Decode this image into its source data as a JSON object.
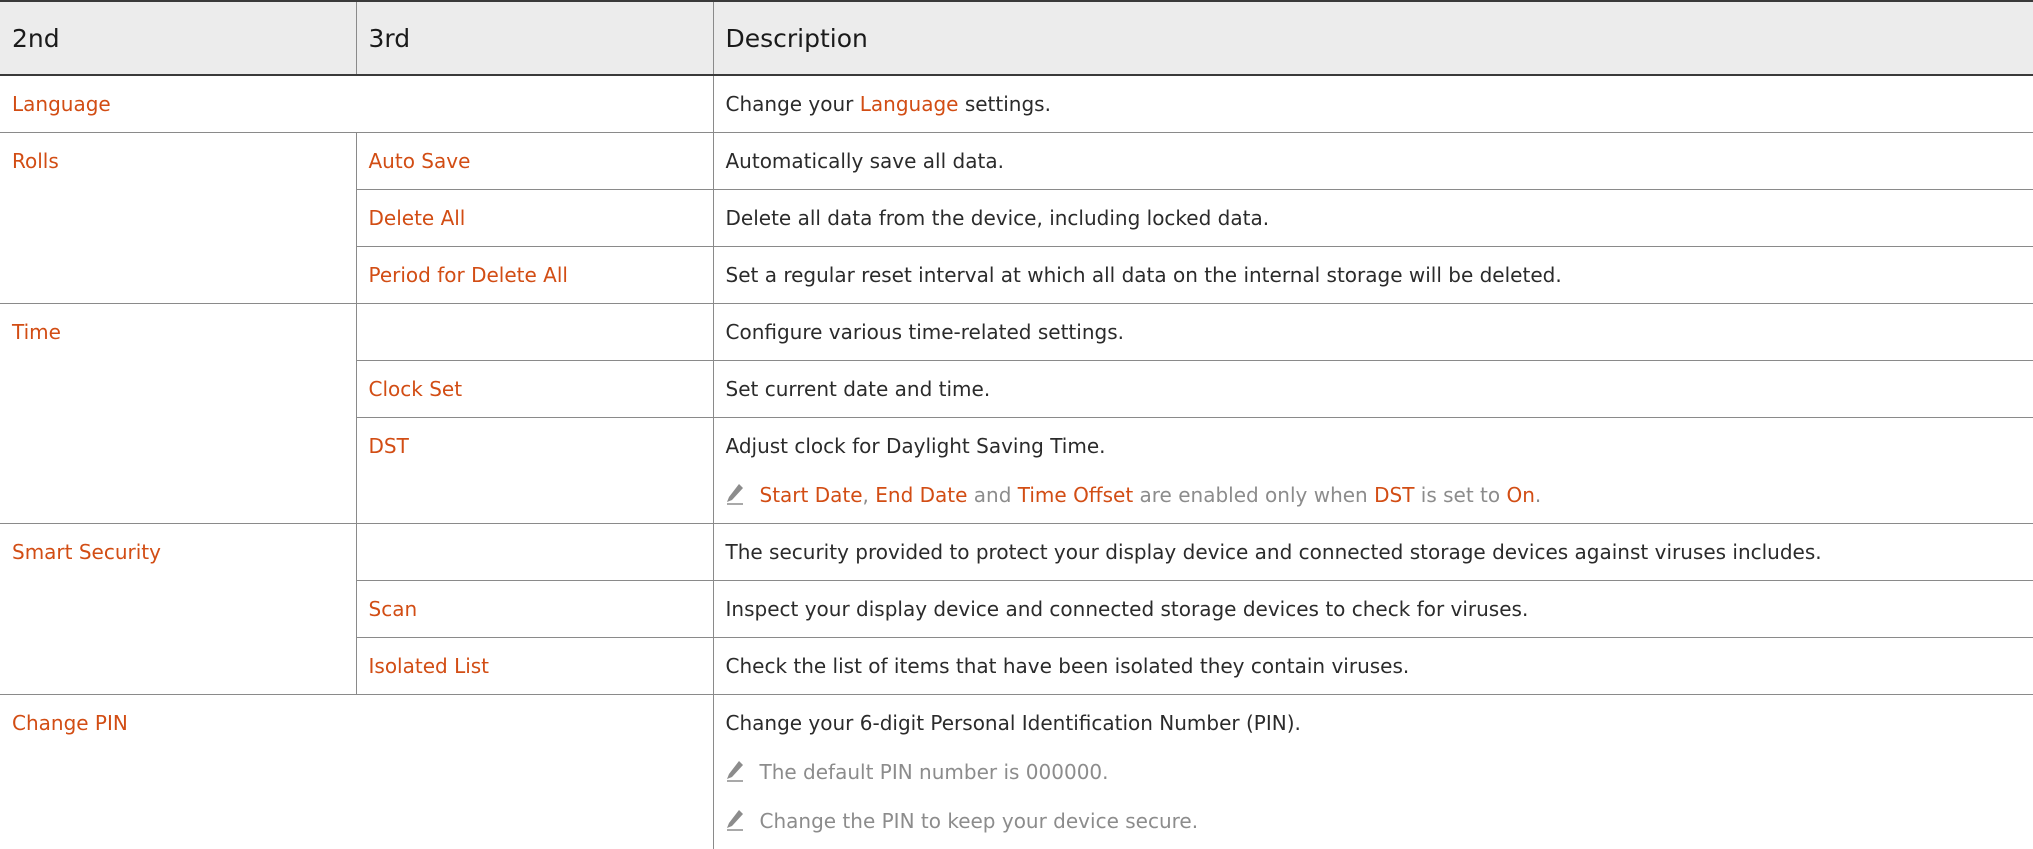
{
  "headers": {
    "col1": "2nd",
    "col2": "3rd",
    "col3": "Description"
  },
  "rows": {
    "language": {
      "label": "Language",
      "desc_pre": "Change your ",
      "desc_hl": "Language",
      "desc_post": " settings."
    },
    "rolls": {
      "label": "Rolls",
      "auto_save": {
        "label": "Auto Save",
        "desc": "Automatically save all data."
      },
      "delete_all": {
        "label": "Delete All",
        "desc": "Delete all data from the device, including locked data."
      },
      "period": {
        "label": "Period for Delete All",
        "desc": "Set a regular reset interval at which all data on the internal storage will be deleted."
      }
    },
    "time": {
      "label": "Time",
      "desc": "Configure various time-related settings.",
      "clock_set": {
        "label": "Clock Set",
        "desc": "Set current date and time."
      },
      "dst": {
        "label": "DST",
        "desc": "Adjust clock for Daylight Saving Time.",
        "note": {
          "t1": "Start Date",
          "t2": ", ",
          "t3": "End Date",
          "t4": " and ",
          "t5": "Time Offset",
          "t6": " are enabled only when ",
          "t7": "DST",
          "t8": " is set to ",
          "t9": "On",
          "t10": "."
        }
      }
    },
    "smart_security": {
      "label": "Smart Security",
      "desc": "The security provided to protect your display device and connected storage devices against viruses includes.",
      "scan": {
        "label": "Scan",
        "desc": "Inspect your display device and connected storage devices to check for viruses."
      },
      "isolated": {
        "label": "Isolated List",
        "desc": "Check the list of items that have been isolated they contain viruses."
      }
    },
    "change_pin": {
      "label": "Change PIN",
      "desc": "Change your 6-digit Personal Identification Number (PIN).",
      "note1": "The default PIN number is 000000.",
      "note2": "Change the PIN to keep your device secure."
    }
  },
  "colors": {
    "highlight": "#d24d14",
    "note": "#8c8c8c",
    "header_bg": "#ececec"
  },
  "icons": {
    "note": "pencil-icon"
  }
}
